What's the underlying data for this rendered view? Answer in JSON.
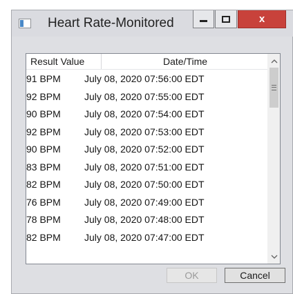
{
  "window": {
    "title": "Heart Rate-Monitored",
    "close_glyph": "x"
  },
  "list": {
    "columns": [
      "Result Value",
      "Date/Time"
    ],
    "rows": [
      {
        "value": "91 BPM",
        "datetime": "July 08, 2020 07:56:00 EDT"
      },
      {
        "value": "92 BPM",
        "datetime": "July 08, 2020 07:55:00 EDT"
      },
      {
        "value": "90 BPM",
        "datetime": "July 08, 2020 07:54:00 EDT"
      },
      {
        "value": "92 BPM",
        "datetime": "July 08, 2020 07:53:00 EDT"
      },
      {
        "value": "90 BPM",
        "datetime": "July 08, 2020 07:52:00 EDT"
      },
      {
        "value": "83 BPM",
        "datetime": "July 08, 2020 07:51:00 EDT"
      },
      {
        "value": "82 BPM",
        "datetime": "July 08, 2020 07:50:00 EDT"
      },
      {
        "value": "76 BPM",
        "datetime": "July 08, 2020 07:49:00 EDT"
      },
      {
        "value": "78 BPM",
        "datetime": "July 08, 2020 07:48:00 EDT"
      },
      {
        "value": "82 BPM",
        "datetime": "July 08, 2020 07:47:00 EDT"
      }
    ]
  },
  "buttons": {
    "ok_label": "OK",
    "ok_enabled": false,
    "cancel_label": "Cancel"
  },
  "icons": {
    "app": "app-window-icon",
    "minimize": "minimize-icon",
    "maximize": "maximize-icon",
    "close": "close-icon",
    "scroll_up": "chevron-up-icon",
    "scroll_down": "chevron-down-icon",
    "scroll_grip": "grip-icon"
  },
  "colors": {
    "close_button": "#c8423b",
    "titlebar": "#dadbe0",
    "window_body": "#dedfe3"
  }
}
